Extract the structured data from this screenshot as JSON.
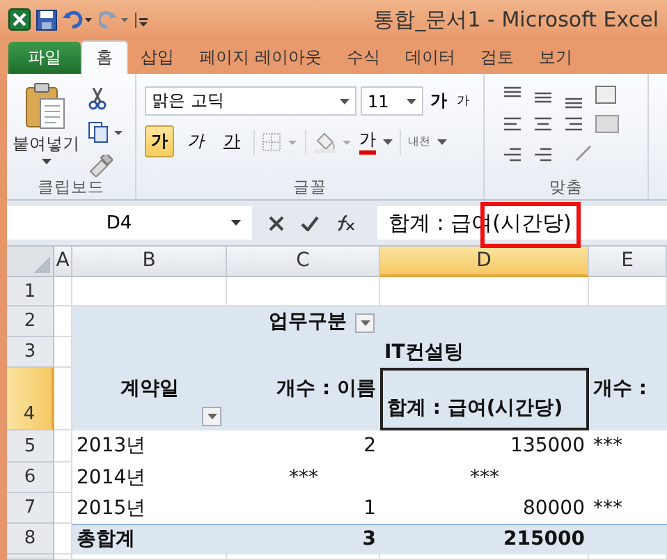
{
  "window": {
    "title": "통합_문서1  -  Microsoft Excel"
  },
  "tabs": [
    {
      "label": "파일",
      "kind": "file",
      "selected": false
    },
    {
      "label": "홈",
      "kind": "tab",
      "selected": true
    },
    {
      "label": "삽입",
      "kind": "tab",
      "selected": false
    },
    {
      "label": "페이지 레이아웃",
      "kind": "tab",
      "selected": false
    },
    {
      "label": "수식",
      "kind": "tab",
      "selected": false
    },
    {
      "label": "데이터",
      "kind": "tab",
      "selected": false
    },
    {
      "label": "검토",
      "kind": "tab",
      "selected": false
    },
    {
      "label": "보기",
      "kind": "tab",
      "selected": false
    }
  ],
  "ribbon": {
    "clipboard": {
      "paste_label": "붙여넣기",
      "label": "클립보드"
    },
    "font": {
      "font_name": "맑은 고딕",
      "font_size": "11",
      "size_buttons": [
        {
          "kind": "grow",
          "label": "가"
        },
        {
          "kind": "shrink",
          "label": "가"
        }
      ],
      "style_buttons": [
        {
          "kind": "bold",
          "label": "가",
          "selected": true
        },
        {
          "kind": "italic",
          "label": "가",
          "selected": false
        },
        {
          "kind": "underline",
          "label": "가",
          "selected": false
        }
      ],
      "font_color_label": "가",
      "phonetic_label": "내천",
      "label": "글꼴"
    },
    "alignment": {
      "label": "맞춤"
    }
  },
  "formula_bar": {
    "name_box": "D4",
    "formula": "합계 : 급여(시간당)"
  },
  "columns": [
    {
      "label": "A",
      "selected": false
    },
    {
      "label": "B",
      "selected": false
    },
    {
      "label": "C",
      "selected": false
    },
    {
      "label": "D",
      "selected": true
    },
    {
      "label": "E",
      "selected": false
    }
  ],
  "rows": [
    {
      "number": "1",
      "selected": false,
      "kind": "blank",
      "cells": {}
    },
    {
      "number": "2",
      "selected": false,
      "kind": "header",
      "cells": {
        "c": {
          "text": "업무구분",
          "kind": "field"
        }
      }
    },
    {
      "number": "3",
      "selected": false,
      "kind": "header",
      "cells": {
        "d": {
          "text": "IT컨설팅",
          "kind": "label"
        }
      }
    },
    {
      "number": "4",
      "selected": true,
      "kind": "header",
      "cells": {
        "b": {
          "text": "계약일",
          "kind": "rowfield"
        },
        "c": {
          "text": "개수 : 이름",
          "kind": "heading"
        },
        "d": {
          "text": "합계 : 급여(시간당)",
          "kind": "caption",
          "selected": true
        },
        "e": {
          "text": "개수 :",
          "kind": "subheading"
        }
      }
    },
    {
      "number": "5",
      "selected": false,
      "kind": "data",
      "cells": {
        "b": {
          "text": "2013년",
          "kind": "label"
        },
        "c": {
          "text": "2",
          "kind": "number"
        },
        "d": {
          "text": "135000",
          "kind": "number"
        },
        "e": {
          "text": "***",
          "kind": "label"
        }
      }
    },
    {
      "number": "6",
      "selected": false,
      "kind": "data",
      "cells": {
        "b": {
          "text": "2014년",
          "kind": "label"
        },
        "c": {
          "text": "***",
          "kind": "masked"
        },
        "d": {
          "text": "***",
          "kind": "masked"
        }
      }
    },
    {
      "number": "7",
      "selected": false,
      "kind": "data",
      "cells": {
        "b": {
          "text": "2015년",
          "kind": "label"
        },
        "c": {
          "text": "1",
          "kind": "number"
        },
        "d": {
          "text": "80000",
          "kind": "number"
        },
        "e": {
          "text": "***",
          "kind": "label"
        }
      }
    },
    {
      "number": "8",
      "selected": false,
      "kind": "total",
      "cells": {
        "b": {
          "text": "총합계",
          "kind": "label"
        },
        "c": {
          "text": "3",
          "kind": "number"
        },
        "d": {
          "text": "215000",
          "kind": "number"
        }
      }
    }
  ]
}
